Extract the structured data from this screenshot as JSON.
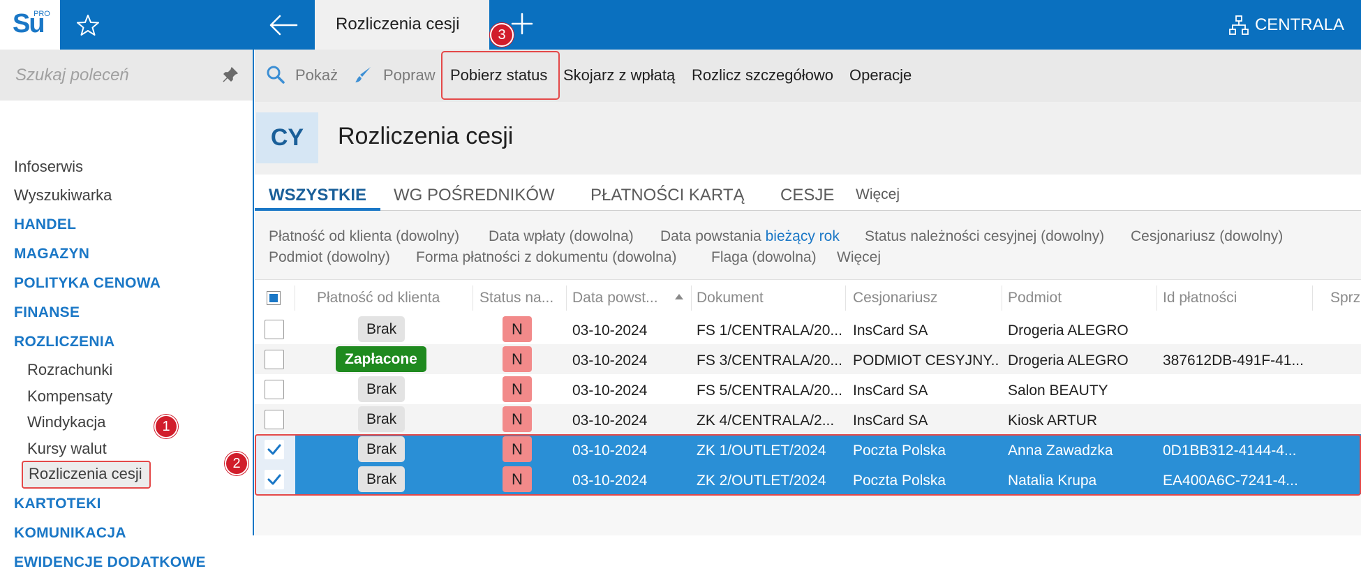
{
  "top": {
    "logo": "Su",
    "logo_sup": "PRO",
    "active_tab": "Rozliczenia cesji",
    "centrala": "CENTRALA",
    "icons": [
      "star-icon",
      "arrow-left-icon",
      "plus-icon",
      "org-structure-icon"
    ]
  },
  "sidebar": {
    "search_placeholder": "Szukaj poleceń",
    "items": [
      {
        "label": "Infoserwis",
        "kind": "item"
      },
      {
        "label": "Wyszukiwarka",
        "kind": "item"
      },
      {
        "label": "HANDEL",
        "kind": "section"
      },
      {
        "label": "MAGAZYN",
        "kind": "section"
      },
      {
        "label": "POLITYKA CENOWA",
        "kind": "section"
      },
      {
        "label": "FINANSE",
        "kind": "section"
      },
      {
        "label": "ROZLICZENIA",
        "kind": "section"
      },
      {
        "label": "Rozrachunki",
        "kind": "sub"
      },
      {
        "label": "Kompensaty",
        "kind": "sub"
      },
      {
        "label": "Windykacja",
        "kind": "sub"
      },
      {
        "label": "Kursy walut",
        "kind": "sub"
      },
      {
        "label": "Rozliczenia cesji",
        "kind": "sub-selected"
      },
      {
        "label": "KARTOTEKI",
        "kind": "section"
      },
      {
        "label": "KOMUNIKACJA",
        "kind": "section"
      },
      {
        "label": "EWIDENCJE DODATKOWE",
        "kind": "section"
      }
    ]
  },
  "badges": [
    "1",
    "2",
    "3"
  ],
  "toolbar": {
    "show": "Pokaż",
    "edit": "Popraw",
    "get_status": "Pobierz status",
    "match_payment": "Skojarz z wpłatą",
    "settle_detailed": "Rozlicz szczegółowo",
    "operations": "Operacje"
  },
  "header": {
    "code": "CY",
    "title": "Rozliczenia cesji"
  },
  "tabs": [
    "WSZYSTKIE",
    "WG POŚREDNIKÓW",
    "PŁATNOŚCI KARTĄ",
    "CESJE",
    "Więcej"
  ],
  "filters": {
    "f1": "Płatność od klienta (dowolny)",
    "f2": "Data wpłaty (dowolna)",
    "f3_label": "Data powstania",
    "f3_value": "bieżący rok",
    "f4": "Status należności cesyjnej (dowolny)",
    "f5": "Cesjonariusz (dowolny)",
    "f6": "Podmiot (dowolny)",
    "f7": "Forma płatności z dokumentu (dowolna)",
    "f8": "Flaga (dowolna)",
    "f9": "Więcej"
  },
  "table": {
    "columns": [
      "Płatność od klienta",
      "Status na...",
      "Data powst...",
      "Dokument",
      "Cesjonariusz",
      "Podmiot",
      "Id płatności",
      "Sprz"
    ],
    "rows": [
      {
        "payment": "Brak",
        "status": "N",
        "date": "03-10-2024",
        "doc": "FS 1/CENTRALA/20...",
        "assignee": "InsCard SA",
        "subject": "Drogeria ALEGRO",
        "pay_id": "",
        "selected": false
      },
      {
        "payment": "Zapłacone",
        "status": "N",
        "date": "03-10-2024",
        "doc": "FS 3/CENTRALA/20...",
        "assignee": "PODMIOT CESYJNY...",
        "subject": "Drogeria ALEGRO",
        "pay_id": "387612DB-491F-41...",
        "selected": false
      },
      {
        "payment": "Brak",
        "status": "N",
        "date": "03-10-2024",
        "doc": "FS 5/CENTRALA/20...",
        "assignee": "InsCard SA",
        "subject": "Salon BEAUTY",
        "pay_id": "",
        "selected": false
      },
      {
        "payment": "Brak",
        "status": "N",
        "date": "03-10-2024",
        "doc": "ZK 4/CENTRALA/2...",
        "assignee": "InsCard SA",
        "subject": "Kiosk ARTUR",
        "pay_id": "",
        "selected": false
      },
      {
        "payment": "Brak",
        "status": "N",
        "date": "03-10-2024",
        "doc": "ZK 1/OUTLET/2024",
        "assignee": "Poczta Polska",
        "subject": "Anna Zawadzka",
        "pay_id": "0D1BB312-4144-4...",
        "selected": true
      },
      {
        "payment": "Brak",
        "status": "N",
        "date": "03-10-2024",
        "doc": "ZK 2/OUTLET/2024",
        "assignee": "Poczta Polska",
        "subject": "Natalia Krupa",
        "pay_id": "EA400A6C-7241-4...",
        "selected": true
      }
    ]
  },
  "colors": {
    "brand_blue": "#0a70bf",
    "selection_blue": "#2a8fd6",
    "paid_green": "#1f8a1f",
    "status_red": "#f28a8a",
    "highlight_red": "#e44848"
  }
}
